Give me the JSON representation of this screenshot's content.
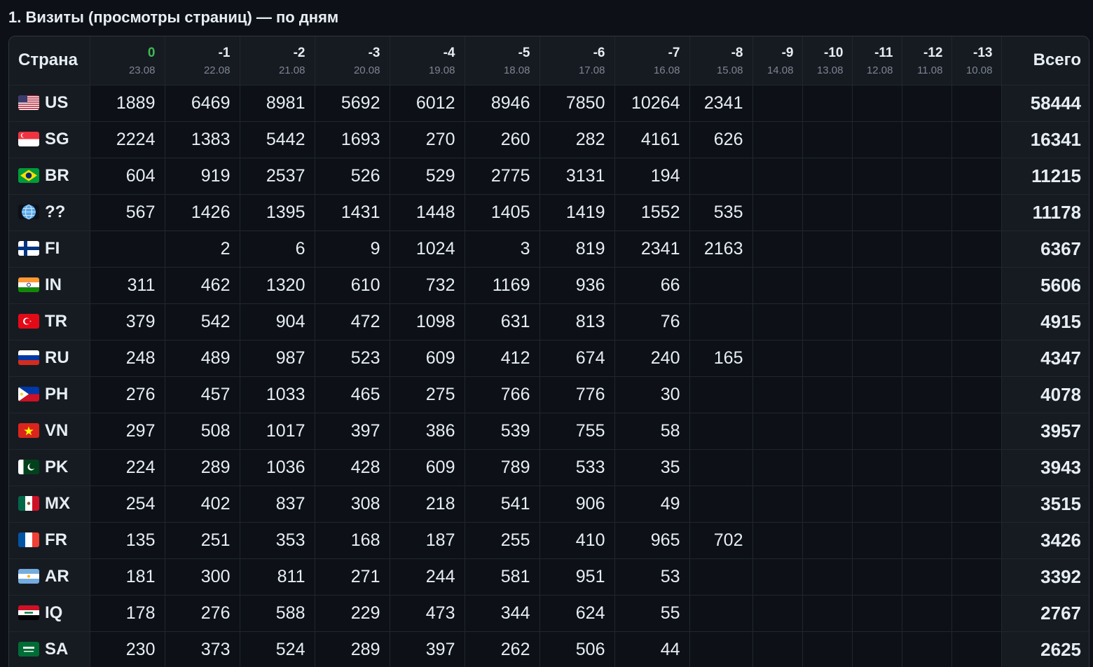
{
  "title": "1. Визиты (просмотры страниц) — по дням",
  "table": {
    "country_header": "Страна",
    "total_header": "Всего",
    "days": [
      {
        "idx": "0",
        "date": "23.08"
      },
      {
        "idx": "-1",
        "date": "22.08"
      },
      {
        "idx": "-2",
        "date": "21.08"
      },
      {
        "idx": "-3",
        "date": "20.08"
      },
      {
        "idx": "-4",
        "date": "19.08"
      },
      {
        "idx": "-5",
        "date": "18.08"
      },
      {
        "idx": "-6",
        "date": "17.08"
      },
      {
        "idx": "-7",
        "date": "16.08"
      },
      {
        "idx": "-8",
        "date": "15.08"
      },
      {
        "idx": "-9",
        "date": "14.08"
      },
      {
        "idx": "-10",
        "date": "13.08"
      },
      {
        "idx": "-11",
        "date": "12.08"
      },
      {
        "idx": "-12",
        "date": "11.08"
      },
      {
        "idx": "-13",
        "date": "10.08"
      }
    ],
    "rows": [
      {
        "code": "US",
        "flag": "us-flag",
        "values": [
          "1889",
          "6469",
          "8981",
          "5692",
          "6012",
          "8946",
          "7850",
          "10264",
          "2341",
          "",
          "",
          "",
          "",
          ""
        ],
        "total": "58444"
      },
      {
        "code": "SG",
        "flag": "sg-flag",
        "values": [
          "2224",
          "1383",
          "5442",
          "1693",
          "270",
          "260",
          "282",
          "4161",
          "626",
          "",
          "",
          "",
          "",
          ""
        ],
        "total": "16341"
      },
      {
        "code": "BR",
        "flag": "br-flag",
        "values": [
          "604",
          "919",
          "2537",
          "526",
          "529",
          "2775",
          "3131",
          "194",
          "",
          "",
          "",
          "",
          "",
          ""
        ],
        "total": "11215"
      },
      {
        "code": "??",
        "flag": "globe-icon",
        "values": [
          "567",
          "1426",
          "1395",
          "1431",
          "1448",
          "1405",
          "1419",
          "1552",
          "535",
          "",
          "",
          "",
          "",
          ""
        ],
        "total": "11178"
      },
      {
        "code": "FI",
        "flag": "fi-flag",
        "values": [
          "",
          "2",
          "6",
          "9",
          "1024",
          "3",
          "819",
          "2341",
          "2163",
          "",
          "",
          "",
          "",
          ""
        ],
        "total": "6367"
      },
      {
        "code": "IN",
        "flag": "in-flag",
        "values": [
          "311",
          "462",
          "1320",
          "610",
          "732",
          "1169",
          "936",
          "66",
          "",
          "",
          "",
          "",
          "",
          ""
        ],
        "total": "5606"
      },
      {
        "code": "TR",
        "flag": "tr-flag",
        "values": [
          "379",
          "542",
          "904",
          "472",
          "1098",
          "631",
          "813",
          "76",
          "",
          "",
          "",
          "",
          "",
          ""
        ],
        "total": "4915"
      },
      {
        "code": "RU",
        "flag": "ru-flag",
        "values": [
          "248",
          "489",
          "987",
          "523",
          "609",
          "412",
          "674",
          "240",
          "165",
          "",
          "",
          "",
          "",
          ""
        ],
        "total": "4347"
      },
      {
        "code": "PH",
        "flag": "ph-flag",
        "values": [
          "276",
          "457",
          "1033",
          "465",
          "275",
          "766",
          "776",
          "30",
          "",
          "",
          "",
          "",
          "",
          ""
        ],
        "total": "4078"
      },
      {
        "code": "VN",
        "flag": "vn-flag",
        "values": [
          "297",
          "508",
          "1017",
          "397",
          "386",
          "539",
          "755",
          "58",
          "",
          "",
          "",
          "",
          "",
          ""
        ],
        "total": "3957"
      },
      {
        "code": "PK",
        "flag": "pk-flag",
        "values": [
          "224",
          "289",
          "1036",
          "428",
          "609",
          "789",
          "533",
          "35",
          "",
          "",
          "",
          "",
          "",
          ""
        ],
        "total": "3943"
      },
      {
        "code": "MX",
        "flag": "mx-flag",
        "values": [
          "254",
          "402",
          "837",
          "308",
          "218",
          "541",
          "906",
          "49",
          "",
          "",
          "",
          "",
          "",
          ""
        ],
        "total": "3515"
      },
      {
        "code": "FR",
        "flag": "fr-flag",
        "values": [
          "135",
          "251",
          "353",
          "168",
          "187",
          "255",
          "410",
          "965",
          "702",
          "",
          "",
          "",
          "",
          ""
        ],
        "total": "3426"
      },
      {
        "code": "AR",
        "flag": "ar-flag",
        "values": [
          "181",
          "300",
          "811",
          "271",
          "244",
          "581",
          "951",
          "53",
          "",
          "",
          "",
          "",
          "",
          ""
        ],
        "total": "3392"
      },
      {
        "code": "IQ",
        "flag": "iq-flag",
        "values": [
          "178",
          "276",
          "588",
          "229",
          "473",
          "344",
          "624",
          "55",
          "",
          "",
          "",
          "",
          "",
          ""
        ],
        "total": "2767"
      },
      {
        "code": "SA",
        "flag": "sa-flag",
        "values": [
          "230",
          "373",
          "524",
          "289",
          "397",
          "262",
          "506",
          "44",
          "",
          "",
          "",
          "",
          "",
          ""
        ],
        "total": "2625"
      }
    ]
  },
  "colors": {
    "background": "#0d1117",
    "header_background": "#161b22",
    "border": "#21262d",
    "text": "#e6edf3",
    "muted": "#7d8590",
    "today_accent": "#3fb950"
  }
}
